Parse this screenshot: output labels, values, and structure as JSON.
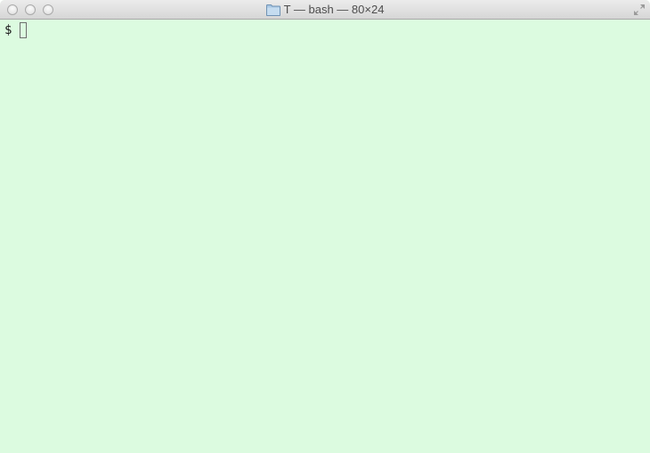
{
  "window": {
    "title": "T — bash — 80×24",
    "background_color": "#dcfbe0"
  },
  "titlebar": {
    "buttons": [
      "close",
      "minimize",
      "zoom"
    ],
    "folder_icon": "folder-icon",
    "fullscreen_icon": "fullscreen-icon"
  },
  "terminal": {
    "prompt": "$",
    "command": "",
    "cursor_style": "block-outline"
  }
}
